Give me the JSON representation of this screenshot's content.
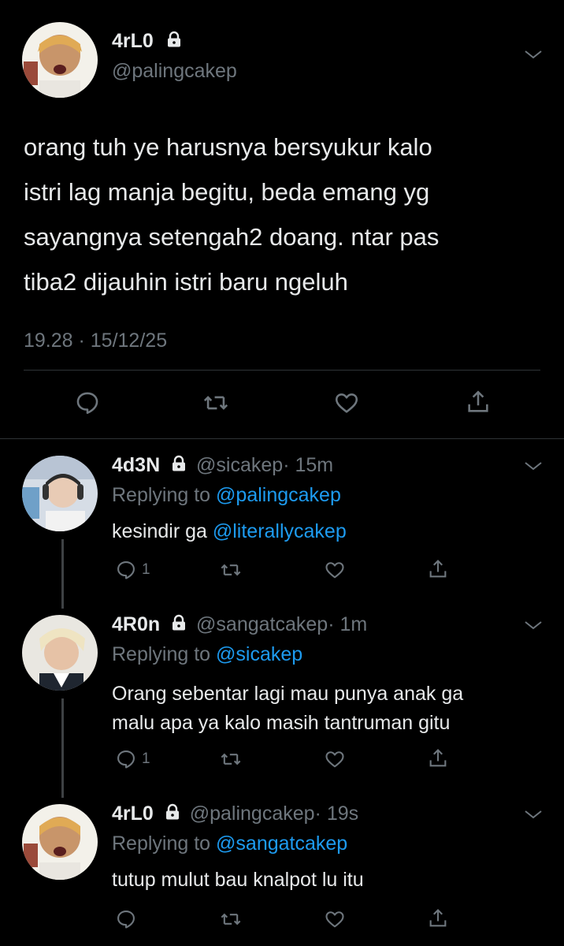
{
  "main_tweet": {
    "name": "4rL0",
    "handle": "@palingcakep",
    "text_lines": [
      "orang tuh ye harusnya bersyukur kalo",
      "istri lag manja begitu, beda emang yg",
      "sayangnya setengah2 doang. ntar pas",
      "tiba2 dijauhin istri baru ngeluh"
    ],
    "timestamp": "19.28 · 15/12/25"
  },
  "replies": [
    {
      "name": "4d3N",
      "handle": "@sicakep",
      "time": "· 15m",
      "replying_label": "Replying to",
      "replying_to": "@sicakep_target",
      "replying_to_display": "@palingcakep",
      "text_prefix": "kesindir ga ",
      "mention": "@literallycakep",
      "text_lines": [],
      "reply_count": "1"
    },
    {
      "name": "4R0n",
      "handle": "@sangatcakep",
      "time": "· 1m",
      "replying_label": "Replying to",
      "replying_to_display": "@sicakep",
      "text_lines": [
        "Orang sebentar lagi mau punya anak ga",
        "malu apa ya kalo masih tantruman gitu"
      ],
      "reply_count": "1"
    },
    {
      "name": "4rL0",
      "handle": "@palingcakep",
      "time": "· 19s",
      "replying_label": "Replying to",
      "replying_to_display": "@sangatcakep",
      "text_lines": [
        "tutup mulut bau knalpot lu itu"
      ],
      "reply_count": ""
    }
  ],
  "icons": {
    "reply": "reply-icon",
    "retweet": "retweet-icon",
    "like": "like-icon",
    "share": "share-icon",
    "lock": "lock-icon",
    "chevron": "chevron-down-icon"
  },
  "colors": {
    "background": "#000000",
    "text": "#e7e9ea",
    "secondary": "#6e767d",
    "link": "#1d9bf0",
    "divider": "#2f3336"
  }
}
